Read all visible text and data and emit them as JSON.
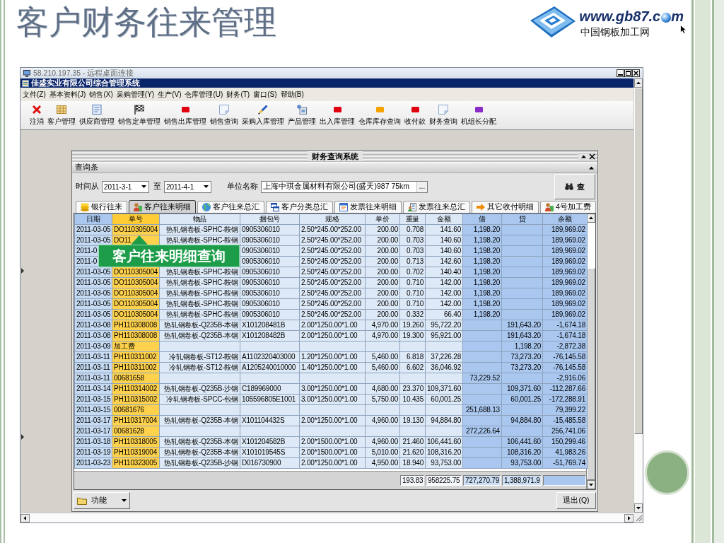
{
  "slide": {
    "title": "客户财务往来管理"
  },
  "logo": {
    "url_start": "www.gb87.c",
    "url_end": "m",
    "tagline": "中国钢板加工网"
  },
  "remote_desktop": {
    "title": "58.210.197.35 - 远程桌面连接"
  },
  "app": {
    "title": "佳盛实业有限公司综合管理系统",
    "menu": [
      "文件(Z)",
      "基本资料(J)",
      "销售(X)",
      "采购管理(Y)",
      "生产(V)",
      "仓库管理(U)",
      "财务(T)",
      "窗口(S)",
      "帮助(B)"
    ],
    "toolbar": [
      {
        "label": "注消",
        "kind": "cross"
      },
      {
        "label": "客户管理",
        "kind": "grid"
      },
      {
        "label": "供应商管理",
        "kind": "sheet"
      },
      {
        "label": "销售定单管理",
        "kind": "flag"
      },
      {
        "label": "销售出库管理",
        "kind": "block",
        "color": "#e00010"
      },
      {
        "label": "销售查询",
        "kind": "note"
      },
      {
        "label": "采购入库管理",
        "kind": "pen"
      },
      {
        "label": "产品管理",
        "kind": "device"
      },
      {
        "label": "出入库管理",
        "kind": "block",
        "color": "#e00010"
      },
      {
        "label": "仓库库存查询",
        "kind": "block",
        "color": "#f5a300"
      },
      {
        "label": "收付款",
        "kind": "block",
        "color": "#e00010"
      },
      {
        "label": "财务查询",
        "kind": "note"
      },
      {
        "label": "机组长分配",
        "kind": "block",
        "color": "#8a2bc8"
      }
    ]
  },
  "finance_window": {
    "title": "财务查询系统",
    "query_section": "查询条",
    "query": {
      "from_label": "时间从",
      "from": "2011-3-1",
      "to_label": "至",
      "to": "2011-4-1",
      "unit_label": "单位名称",
      "unit": "上海中琪金属材料有限公司(盛天)987 75km",
      "browse": "...",
      "search": "查"
    },
    "tabs": [
      {
        "label": "银行往来",
        "kind": "coins",
        "selected": false
      },
      {
        "label": "客户往来明细",
        "kind": "user",
        "selected": true
      },
      {
        "label": "客户往来总汇",
        "kind": "globe",
        "selected": false
      },
      {
        "label": "客户分类总汇",
        "kind": "windows",
        "selected": false
      },
      {
        "label": "发票往来明细",
        "kind": "form",
        "selected": false
      },
      {
        "label": "发票往来总汇",
        "kind": "report",
        "selected": false
      },
      {
        "label": "其它收付明细",
        "kind": "arrow",
        "selected": false
      },
      {
        "label": "4号加工费",
        "kind": "user",
        "selected": false
      }
    ],
    "table": {
      "columns": [
        {
          "label": "日期",
          "kind": "date",
          "total_box": false
        },
        {
          "label": "单号",
          "kind": "key",
          "total_box": false
        },
        {
          "label": "物品",
          "kind": "item",
          "total_box": false
        },
        {
          "label": "捆包号",
          "kind": "code",
          "total_box": false
        },
        {
          "label": "规格",
          "kind": "code",
          "total_box": false
        },
        {
          "label": "单价",
          "kind": "number",
          "total_box": false
        },
        {
          "label": "重量",
          "kind": "number",
          "total_box": true,
          "total": "193.83"
        },
        {
          "label": "金额",
          "kind": "number",
          "total_box": true,
          "total": "958225.75"
        },
        {
          "label": "借",
          "kind": "ledger",
          "total_box": true,
          "total": "727,270.79"
        },
        {
          "label": "贷",
          "kind": "ledger",
          "total_box": true,
          "total": "1,388,971.9"
        },
        {
          "label": "余额",
          "kind": "ledger",
          "total_box": true
        }
      ],
      "rows": [
        [
          "2011-03-05",
          "DO110305004",
          "热轧钢卷板-SPHC-鞍钢",
          "0905306010",
          "2.50*245.00*252.00",
          "200.00",
          "0.708",
          "141.60",
          "1,198.20",
          null,
          "189,969.02"
        ],
        [
          "2011-03-05",
          "DO11",
          "热轧钢卷板-SPHC-鞍钢",
          "0905306010",
          "2.50*245.00*252.00",
          "200.00",
          "0.703",
          "140.60",
          "1,198.20",
          null,
          "189,969.02"
        ],
        [
          "2011-0",
          null,
          null,
          "0905306010",
          "2.50*245.00*252.00",
          "200.00",
          "0.703",
          "140.60",
          "1,198.20",
          null,
          "189,969.02"
        ],
        [
          "2011-0",
          null,
          null,
          "0905306010",
          "2.50*245.00*252.00",
          "200.00",
          "0.713",
          "142.60",
          "1,198.20",
          null,
          "189,969.02"
        ],
        [
          "2011-03-05",
          "DO110305004",
          "热轧钢卷板-SPHC-鞍钢",
          "0905306010",
          "2.50*245.00*252.00",
          "200.00",
          "0.702",
          "140.40",
          "1,198.20",
          null,
          "189,969.02"
        ],
        [
          "2011-03-05",
          "DO110305004",
          "热轧钢卷板-SPHC-鞍钢",
          "0905306010",
          "2.50*245.00*252.00",
          "200.00",
          "0.710",
          "142.00",
          "1,198.20",
          null,
          "189,969.02"
        ],
        [
          "2011-03-05",
          "DO110305004",
          "热轧钢卷板-SPHC-鞍钢",
          "0905306010",
          "2.50*245.00*252.00",
          "200.00",
          "0.710",
          "142.00",
          "1,198.20",
          null,
          "189,969.02"
        ],
        [
          "2011-03-05",
          "DO110305004",
          "热轧钢卷板-SPHC-鞍钢",
          "0905306010",
          "2.50*245.00*252.00",
          "200.00",
          "0.710",
          "142.00",
          "1,198.20",
          null,
          "189,969.02"
        ],
        [
          "2011-03-05",
          "DO110305004",
          "热轧钢卷板-SPHC-鞍钢",
          "0905306010",
          "2.50*245.00*252.00",
          "200.00",
          "0.332",
          "66.40",
          "1,198.20",
          null,
          "189,969.02"
        ],
        [
          "2011-03-08",
          "PH110308008",
          "热轧钢卷板-Q235B-本钢",
          "X101208481B",
          "2.00*1250.00*1.00",
          "4,970.00",
          "19.260",
          "95,722.20",
          null,
          "191,643.20",
          "-1,674.18"
        ],
        [
          "2011-03-08",
          "PH110308008",
          "热轧钢卷板-Q235B-本钢",
          "X101208482B",
          "2.00*1250.00*1.00",
          "4,970.00",
          "19.300",
          "95,921.00",
          null,
          "191,643.20",
          "-1,674.18"
        ],
        [
          "2011-03-09",
          "加工费",
          null,
          null,
          null,
          null,
          null,
          null,
          null,
          "1,198.20",
          "-2,872.38"
        ],
        [
          "2011-03-11",
          "PH110311002",
          "冷轧钢卷板-ST12-鞍钢",
          "A1102320403000",
          "1.20*1250.00*1.00",
          "5,460.00",
          "6.818",
          "37,226.28",
          null,
          "73,273.20",
          "-76,145.58"
        ],
        [
          "2011-03-11",
          "PH110311002",
          "冷轧钢卷板-ST12-鞍钢",
          "A1205240010000",
          "1.40*1250.00*1.00",
          "5,460.00",
          "6.602",
          "36,046.92",
          null,
          "73,273.20",
          "-76,145.58"
        ],
        [
          "2011-03-11",
          "00681658",
          null,
          null,
          null,
          null,
          null,
          null,
          "73,229.52",
          null,
          "-2,916.06"
        ],
        [
          "2011-03-14",
          "PH110314002",
          "热轧钢卷板-Q235B-沙钢",
          "C189969000",
          "3.00*1250.00*1.00",
          "4,680.00",
          "23.370",
          "109,371.60",
          null,
          "109,371.60",
          "-112,287.66"
        ],
        [
          "2011-03-15",
          "PH110315002",
          "冷轧钢卷板-SPCC-包钢",
          "105596805E1001",
          "3.00*1250.00*1.00",
          "5,750.00",
          "10.435",
          "60,001.25",
          null,
          "60,001.25",
          "-172,288.91"
        ],
        [
          "2011-03-15",
          "00681676",
          null,
          null,
          null,
          null,
          null,
          null,
          "251,688.13",
          null,
          "79,399.22"
        ],
        [
          "2011-03-17",
          "PH110317004",
          "热轧钢卷板-Q235B-本钢",
          "X101104432S",
          "2.00*1250.00*1.00",
          "4,960.00",
          "19.130",
          "94,884.80",
          null,
          "94,884.80",
          "-15,485.58"
        ],
        [
          "2011-03-17",
          "00681628",
          null,
          null,
          null,
          null,
          null,
          null,
          "272,226.64",
          null,
          "256,741.06"
        ],
        [
          "2011-03-18",
          "PH110318005",
          "热轧钢卷板-Q235B-本钢",
          "X101204582B",
          "2.00*1500.00*1.00",
          "4,960.00",
          "21.460",
          "106,441.60",
          null,
          "106,441.60",
          "150,299.46"
        ],
        [
          "2011-03-19",
          "PH110319004",
          "热轧钢卷板-Q235B-本钢",
          "X101019545S",
          "2.00*1500.00*1.00",
          "5,010.00",
          "21.620",
          "108,316.20",
          null,
          "108,316.20",
          "41,983.26"
        ],
        [
          "2011-03-23",
          "PH110323005",
          "热轧钢卷板-Q235B-沙钢",
          "D016730900",
          "2.00*1250.00*1.00",
          "4,950.00",
          "18.940",
          "93,753.00",
          null,
          "93,753.00",
          "-51,769.74"
        ]
      ]
    },
    "function_button": "功能",
    "exit_button": "退出(Q)"
  },
  "callout": {
    "text": "客户往来明细查询"
  }
}
